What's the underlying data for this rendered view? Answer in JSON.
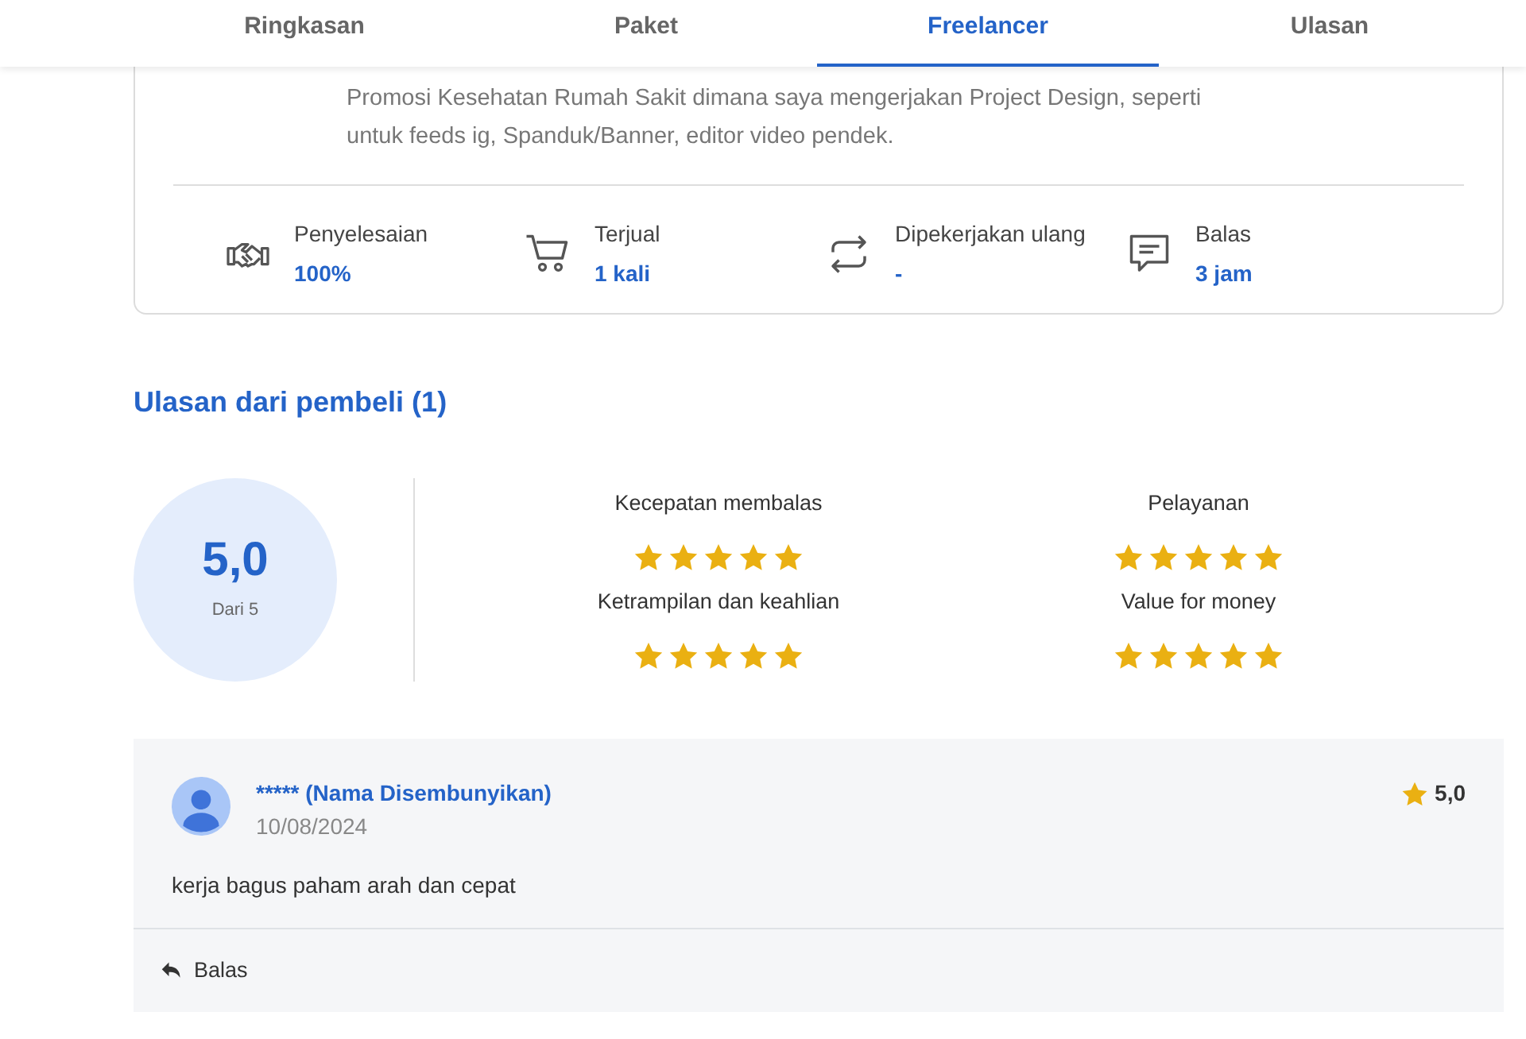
{
  "tabs": [
    {
      "label": "Ringkasan",
      "selected": false
    },
    {
      "label": "Paket",
      "selected": false
    },
    {
      "label": "Freelancer",
      "selected": true
    },
    {
      "label": "Ulasan",
      "selected": false
    }
  ],
  "about": {
    "lines": [
      "Promosi Kesehatan Rumah Sakit dimana saya mengerjakan Project Design, seperti",
      "untuk feeds ig, Spanduk/Banner, editor video pendek."
    ]
  },
  "stats": [
    {
      "kind": "handshake",
      "label": "Penyelesaian",
      "value": "100%"
    },
    {
      "kind": "cart",
      "label": "Terjual",
      "value": "1 kali"
    },
    {
      "kind": "repeat",
      "label": "Dipekerjakan ulang",
      "value": "-"
    },
    {
      "kind": "chat",
      "label": "Balas",
      "value": "3 jam"
    }
  ],
  "reviews_section": {
    "title": "Ulasan dari pembeli (1)",
    "score": "5,0",
    "score_caption": "Dari 5",
    "categories": [
      {
        "label": "Kecepatan membalas",
        "stars": 5
      },
      {
        "label": "Pelayanan",
        "stars": 5
      },
      {
        "label": "Ketrampilan dan keahlian",
        "stars": 5
      },
      {
        "label": "Value for money",
        "stars": 5
      }
    ]
  },
  "reviews": [
    {
      "author": "***** (Nama Disembunyikan)",
      "date": "10/08/2024",
      "rating": "5,0",
      "text": "kerja bagus paham arah dan cepat",
      "reply_label": "Balas"
    }
  ]
}
